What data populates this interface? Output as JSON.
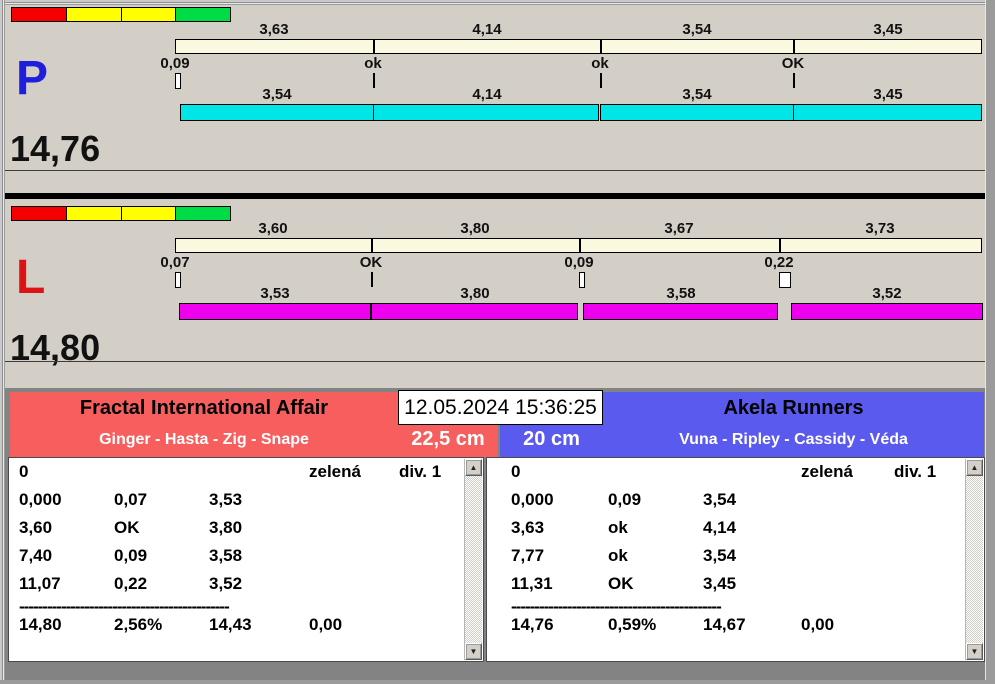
{
  "datetime": "12.05.2024 15:36:25",
  "icons": {
    "scroll_up": "▲",
    "scroll_down": "▼"
  },
  "traffic_light": {
    "colors": [
      "#F40000",
      "#FFFF00",
      "#FFFF00",
      "#00DC46"
    ]
  },
  "lanes": [
    {
      "letter": "P",
      "letter_color": "#1E1EDC",
      "total_label": "14,76",
      "total_sec": 14.76,
      "bar_color": "#00E6E6",
      "splits": [
        {
          "label": "3,63",
          "sec": 3.63
        },
        {
          "label": "4,14",
          "sec": 4.14
        },
        {
          "label": "3,54",
          "sec": 3.54
        },
        {
          "label": "3,45",
          "sec": 3.45
        }
      ],
      "changeovers": [
        {
          "label": "0,09",
          "loss": 0.09
        },
        {
          "label": "ok",
          "loss": 0
        },
        {
          "label": "ok",
          "loss": 0
        },
        {
          "label": "OK",
          "loss": 0
        }
      ],
      "dogs": [
        {
          "label": "3,54",
          "sec": 3.54
        },
        {
          "label": "4,14",
          "sec": 4.14
        },
        {
          "label": "3,54",
          "sec": 3.54
        },
        {
          "label": "3,45",
          "sec": 3.45
        }
      ]
    },
    {
      "letter": "L",
      "letter_color": "#DE1212",
      "total_label": "14,80",
      "total_sec": 14.8,
      "bar_color": "#EE00EE",
      "splits": [
        {
          "label": "3,60",
          "sec": 3.6
        },
        {
          "label": "3,80",
          "sec": 3.8
        },
        {
          "label": "3,67",
          "sec": 3.67
        },
        {
          "label": "3,73",
          "sec": 3.73
        }
      ],
      "changeovers": [
        {
          "label": "0,07",
          "loss": 0.07
        },
        {
          "label": "OK",
          "loss": 0
        },
        {
          "label": "0,09",
          "loss": 0.09
        },
        {
          "label": "0,22",
          "loss": 0.22
        }
      ],
      "dogs": [
        {
          "label": "3,53",
          "sec": 3.53
        },
        {
          "label": "3,80",
          "sec": 3.8
        },
        {
          "label": "3,58",
          "sec": 3.58
        },
        {
          "label": "3,52",
          "sec": 3.52
        }
      ]
    }
  ],
  "teams": [
    {
      "name": "Fractal International Affair",
      "dogs_line": "Ginger - Hasta - Zig - Snape",
      "height": "22,5 cm",
      "color": "#F75F5F",
      "table": {
        "status_row": {
          "c1": "0",
          "c4": "zelená",
          "c5": "div. 1"
        },
        "rows": [
          [
            "0,000",
            "0,07",
            "3,53"
          ],
          [
            "3,60",
            "OK",
            "3,80"
          ],
          [
            "7,40",
            "0,09",
            "3,58"
          ],
          [
            "11,07",
            "0,22",
            "3,52"
          ]
        ],
        "separator": "---------------------------------------------",
        "total_row": [
          "14,80",
          "2,56%",
          "14,43",
          "0,00"
        ]
      }
    },
    {
      "name": "Akela Runners",
      "dogs_line": "Vuna - Ripley - Cassidy - Véda",
      "height": "20 cm",
      "color": "#5A5AEE",
      "table": {
        "status_row": {
          "c1": "0",
          "c4": "zelená",
          "c5": "div. 1"
        },
        "rows": [
          [
            "0,000",
            "0,09",
            "3,54"
          ],
          [
            "3,63",
            "ok",
            "4,14"
          ],
          [
            "7,77",
            "ok",
            "3,54"
          ],
          [
            "11,31",
            "OK",
            "3,45"
          ]
        ],
        "separator": "---------------------------------------------",
        "total_row": [
          "14,76",
          "0,59%",
          "14,67",
          "0,00"
        ]
      }
    }
  ]
}
